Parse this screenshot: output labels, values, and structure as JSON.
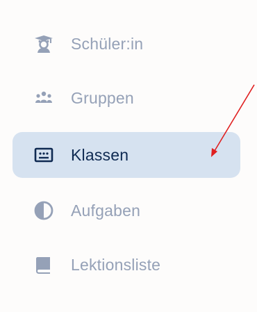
{
  "nav": {
    "items": [
      {
        "label": "Schüler:in",
        "icon": "graduate-icon",
        "active": false
      },
      {
        "label": "Gruppen",
        "icon": "group-icon",
        "active": false
      },
      {
        "label": "Klassen",
        "icon": "classroom-icon",
        "active": true
      },
      {
        "label": "Aufgaben",
        "icon": "pie-chart-icon",
        "active": false
      },
      {
        "label": "Lektionsliste",
        "icon": "book-icon",
        "active": false
      }
    ]
  },
  "colors": {
    "background": "#fdfcfb",
    "active_bg": "#d6e2f0",
    "active_text": "#0f2a52",
    "inactive": "#95a1b7",
    "annotation_arrow": "#e02020"
  }
}
